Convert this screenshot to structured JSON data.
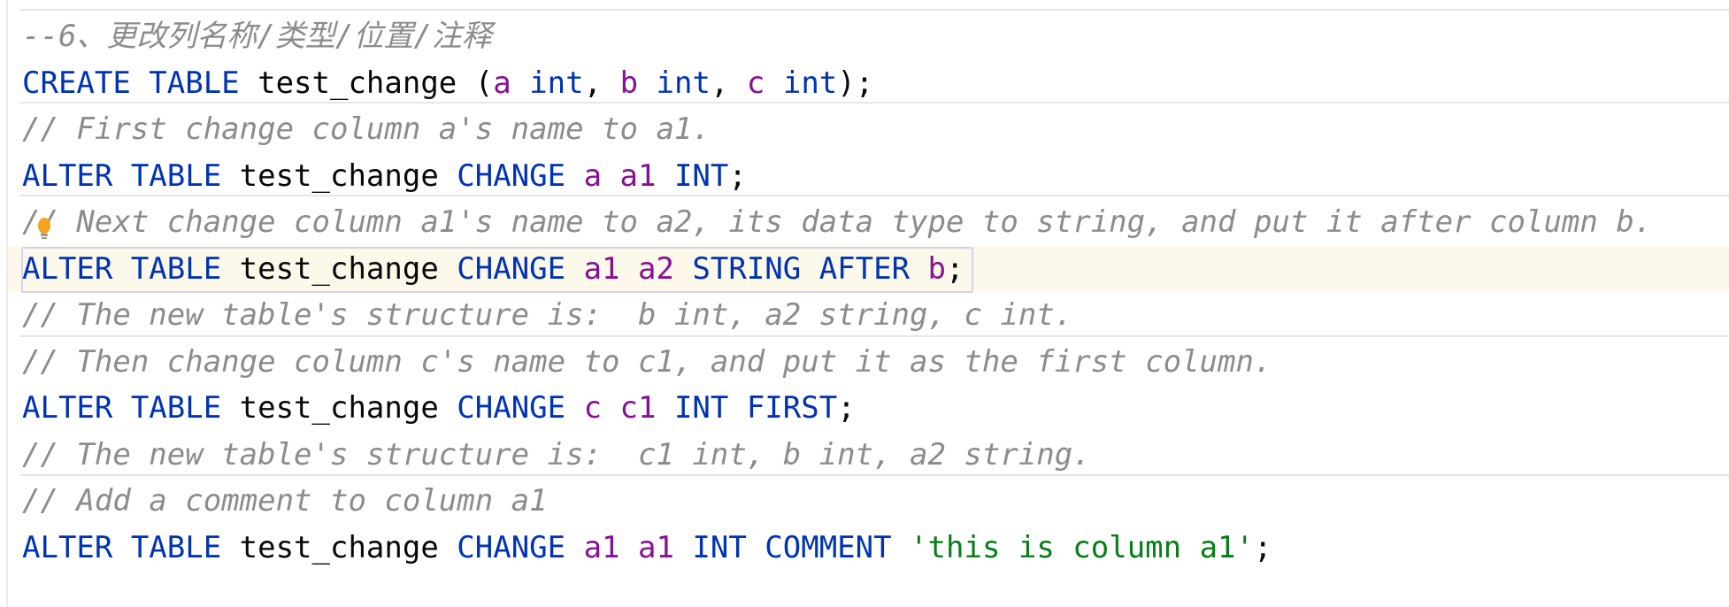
{
  "editor": {
    "colors": {
      "keyword": "#0033b3",
      "identifier": "#080808",
      "column": "#871094",
      "string": "#067d17",
      "comment": "#8c8c8c",
      "caret_row": "#fcf8ea"
    },
    "caret_line": 6,
    "intention_icon": "lightbulb-icon",
    "lines": [
      [
        [
          "--6、更改列名称/类型/位置/注释",
          "cm"
        ]
      ],
      [
        [
          "CREATE TABLE ",
          "kw"
        ],
        [
          "test_change ",
          "id"
        ],
        [
          "(",
          "id"
        ],
        [
          "a ",
          "col"
        ],
        [
          "int",
          "kw"
        ],
        [
          ", ",
          "id"
        ],
        [
          "b ",
          "col"
        ],
        [
          "int",
          "kw"
        ],
        [
          ", ",
          "id"
        ],
        [
          "c ",
          "col"
        ],
        [
          "int",
          "kw"
        ],
        [
          ");",
          "id"
        ]
      ],
      [
        [
          "// First change column a's name to a1.",
          "cm"
        ]
      ],
      [
        [
          "ALTER TABLE ",
          "kw"
        ],
        [
          "test_change ",
          "id"
        ],
        [
          "CHANGE ",
          "kw"
        ],
        [
          "a ",
          "col"
        ],
        [
          "a1 ",
          "col"
        ],
        [
          "INT",
          "kw"
        ],
        [
          ";",
          "id"
        ]
      ],
      [
        [
          "// Next change column a1's name to a2, its data type to string, and put it after column b.",
          "cm"
        ]
      ],
      [
        [
          "ALTER TABLE ",
          "kw"
        ],
        [
          "test_change ",
          "id"
        ],
        [
          "CHANGE ",
          "kw"
        ],
        [
          "a1 ",
          "col"
        ],
        [
          "a2 ",
          "col"
        ],
        [
          "STRING AFTER ",
          "kw"
        ],
        [
          "b",
          "col"
        ],
        [
          ";",
          "id"
        ]
      ],
      [
        [
          "// The new table's structure is:  b int, a2 string, c int.",
          "cm"
        ]
      ],
      [
        [
          "// Then change column c's name to c1, and put it as the first column.",
          "cm"
        ]
      ],
      [
        [
          "ALTER TABLE ",
          "kw"
        ],
        [
          "test_change ",
          "id"
        ],
        [
          "CHANGE ",
          "kw"
        ],
        [
          "c ",
          "col"
        ],
        [
          "c1 ",
          "col"
        ],
        [
          "INT FIRST",
          "kw"
        ],
        [
          ";",
          "id"
        ]
      ],
      [
        [
          "// The new table's structure is:  c1 int, b int, a2 string.",
          "cm"
        ]
      ],
      [
        [
          "// Add a comment to column a1",
          "cm"
        ]
      ],
      [
        [
          "ALTER TABLE ",
          "kw"
        ],
        [
          "test_change ",
          "id"
        ],
        [
          "CHANGE ",
          "kw"
        ],
        [
          "a1 ",
          "col"
        ],
        [
          "a1 ",
          "col"
        ],
        [
          "INT COMMENT ",
          "kw"
        ],
        [
          "'this is column a1'",
          "str"
        ],
        [
          ";",
          "id"
        ]
      ]
    ]
  }
}
